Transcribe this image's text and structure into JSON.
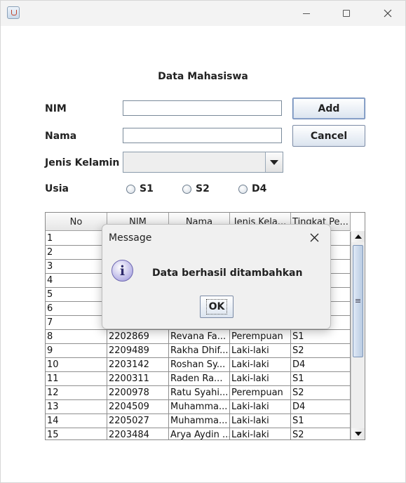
{
  "window": {
    "title": "",
    "icon": "java-icon"
  },
  "form": {
    "title": "Data Mahasiswa",
    "labels": {
      "nim": "NIM",
      "nama": "Nama",
      "jenis_kelamin": "Jenis Kelamin",
      "usia": "Usia"
    },
    "inputs": {
      "nim_value": "",
      "nama_value": "",
      "jenis_kelamin_selected": ""
    },
    "radios": {
      "s1": "S1",
      "s2": "S2",
      "d4": "D4"
    },
    "buttons": {
      "add": "Add",
      "cancel": "Cancel"
    }
  },
  "table": {
    "columns": [
      "No",
      "NIM",
      "Nama",
      "Jenis Kela...",
      "Tingkat Pe..."
    ],
    "rows": [
      [
        "1",
        "",
        "",
        "",
        ""
      ],
      [
        "2",
        "",
        "",
        "",
        ""
      ],
      [
        "3",
        "",
        "",
        "",
        ""
      ],
      [
        "4",
        "",
        "",
        "",
        ""
      ],
      [
        "5",
        "",
        "",
        "",
        ""
      ],
      [
        "6",
        "",
        "",
        "",
        ""
      ],
      [
        "7",
        "",
        "",
        "",
        ""
      ],
      [
        "8",
        "2202869",
        "Revana Fa...",
        "Perempuan",
        "S1"
      ],
      [
        "9",
        "2209489",
        "Rakha Dhif...",
        "Laki-laki",
        "S2"
      ],
      [
        "10",
        "2203142",
        "Roshan Sy...",
        "Laki-laki",
        "D4"
      ],
      [
        "11",
        "2200311",
        "Raden Ra...",
        "Laki-laki",
        "S1"
      ],
      [
        "12",
        "2200978",
        "Ratu Syahi...",
        "Perempuan",
        "S2"
      ],
      [
        "13",
        "2204509",
        "Muhamma...",
        "Laki-laki",
        "D4"
      ],
      [
        "14",
        "2205027",
        "Muhamma...",
        "Laki-laki",
        "S1"
      ],
      [
        "15",
        "2203484",
        "Arya Aydin ...",
        "Laki-laki",
        "S2"
      ]
    ]
  },
  "dialog": {
    "title": "Message",
    "message": "Data berhasil ditambahkan",
    "ok_label": "OK",
    "icon": "info-icon"
  }
}
